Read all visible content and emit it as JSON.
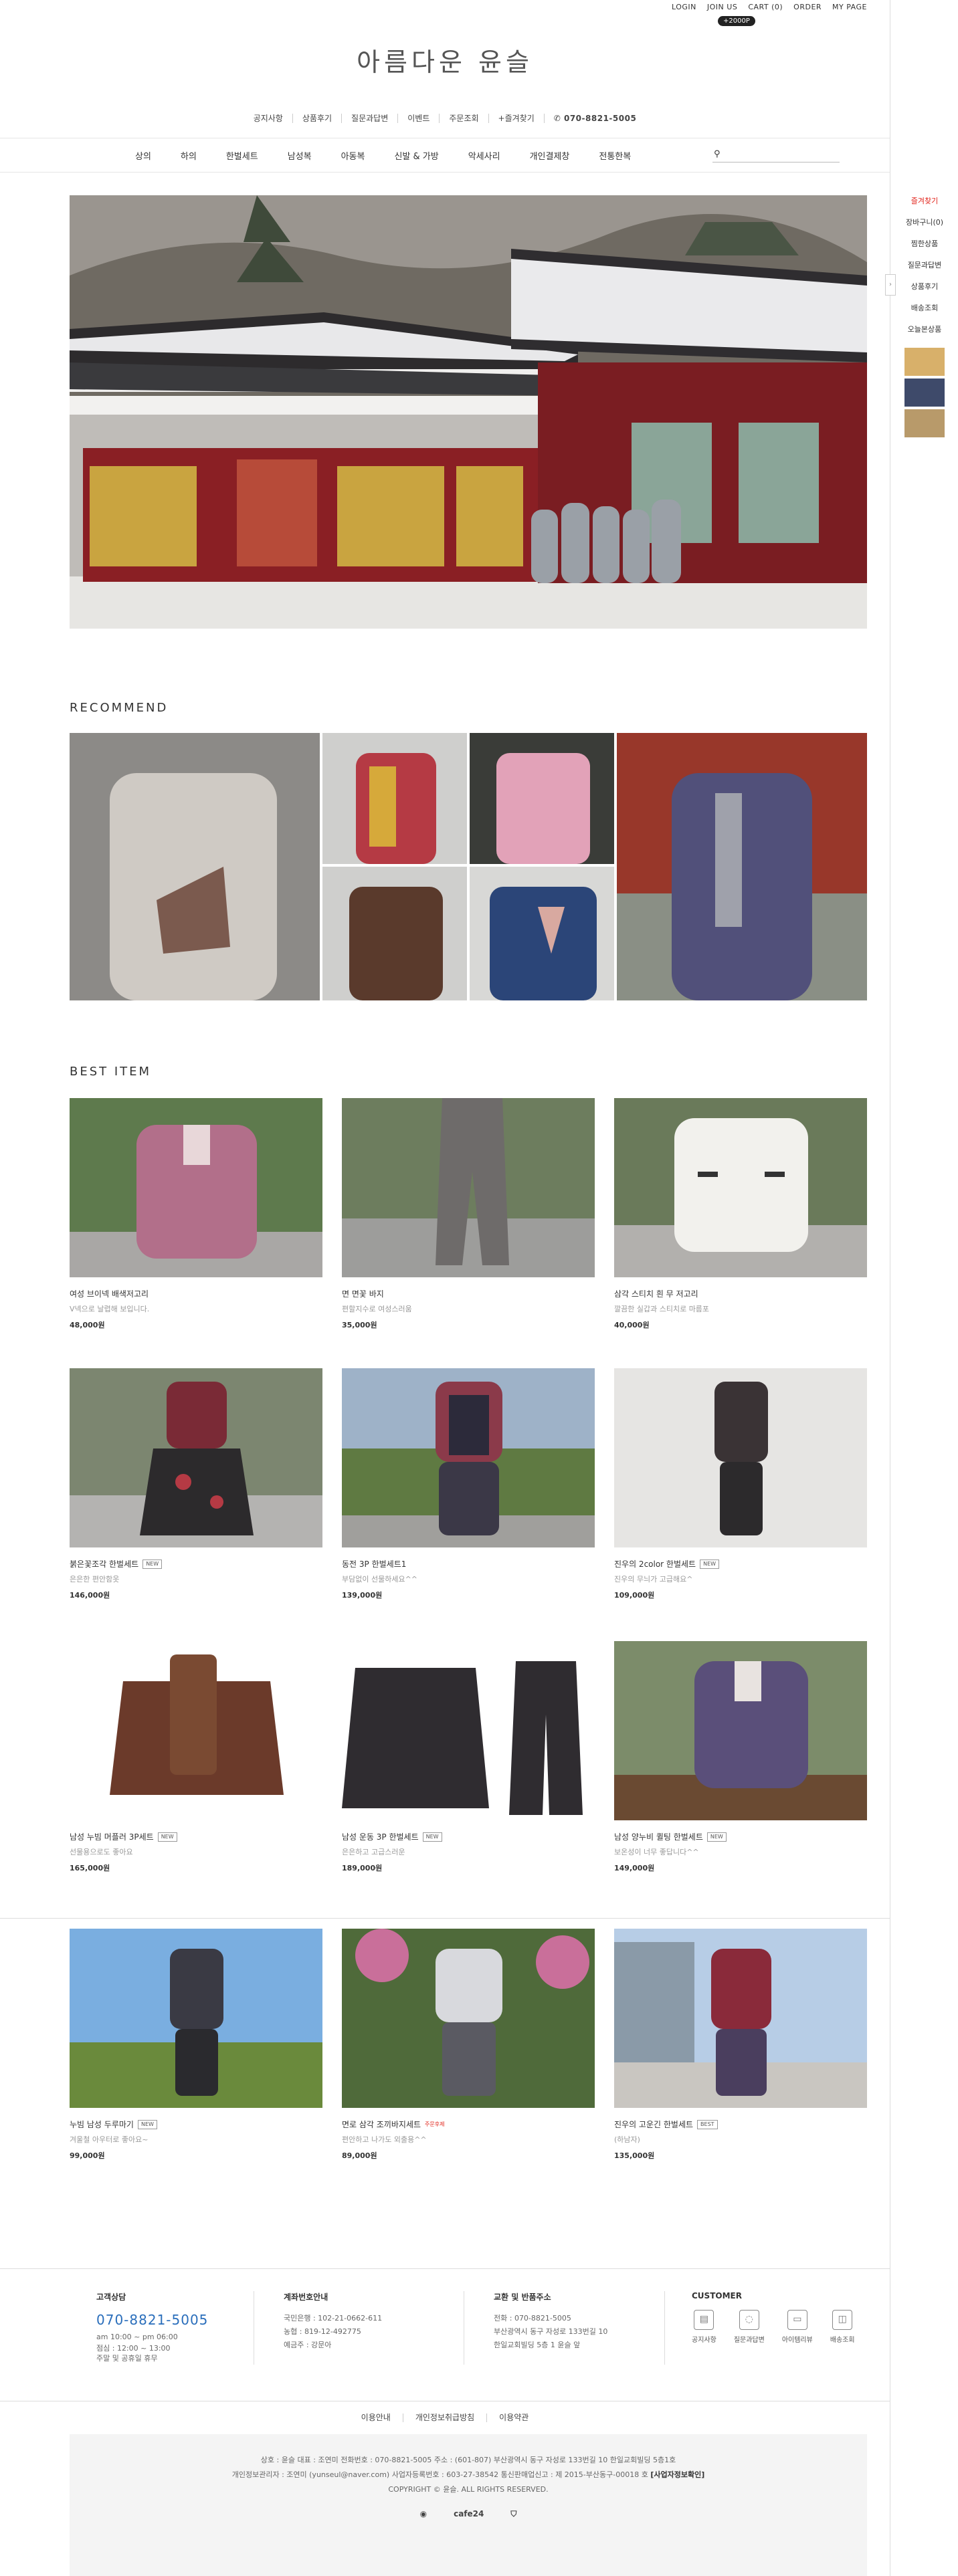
{
  "top_links": [
    "LOGIN",
    "JOIN US",
    "CART (0)",
    "ORDER",
    "MY PAGE"
  ],
  "point_badge": "+2000P",
  "logo": "아름다운 윤슬",
  "sub_nav": [
    "공지사항",
    "상품후기",
    "질문과답변",
    "이벤트",
    "주문조회",
    "+즐겨찾기"
  ],
  "phone": "070-8821-5005",
  "main_nav": [
    "상의",
    "하의",
    "한벌세트",
    "남성복",
    "아동복",
    "신발 & 가방",
    "악세사리",
    "개인결제창",
    "전통한복"
  ],
  "quick": {
    "items": [
      "즐겨찾기",
      "장바구니(0)",
      "찜한상품",
      "질문과답변",
      "상품후기",
      "배송조회",
      "오늘본상품"
    ]
  },
  "sections": {
    "recommend": "RECOMMEND",
    "best": "BEST ITEM"
  },
  "products": [
    {
      "name": "여성 브이넥 배색저고리",
      "desc": "V넥으로 날렵해 보입니다.",
      "price": "48,000원",
      "tag": ""
    },
    {
      "name": "면 면꽃 바지",
      "desc": "편할지수로 여성스러움",
      "price": "35,000원",
      "tag": ""
    },
    {
      "name": "삼각 스티치 흰 무 저고리",
      "desc": "깔끔한 실갑과 스티치로 마름포",
      "price": "40,000원",
      "tag": ""
    },
    {
      "name": "붉은꽃조각 한벌세트",
      "desc": "은은한 편안함옷",
      "price": "146,000원",
      "tag": "NEW"
    },
    {
      "name": "동전 3P 한벌세트1",
      "desc": "부담없이 선물하세요^^",
      "price": "139,000원",
      "tag": ""
    },
    {
      "name": "진우의 2color 한벌세트",
      "desc": "진우의 무늬가 고급해요^",
      "price": "109,000원",
      "tag": "NEW"
    },
    {
      "name": "남성 누빔 머플러 3P세트",
      "desc": "선물용으로도 좋아요",
      "price": "165,000원",
      "tag": "NEW"
    },
    {
      "name": "남성 운동 3P 한벌세트",
      "desc": "은은하고 고급스러운",
      "price": "189,000원",
      "tag": "NEW"
    },
    {
      "name": "남성 양누비 퀼팅 한벌세트",
      "desc": "보온성이 너무 좋답니다^^",
      "price": "149,000원",
      "tag": "NEW"
    },
    {
      "name": "누빔 남성 두루마기",
      "desc": "겨울철 아우터로 좋아요~",
      "price": "99,000원",
      "tag": "NEW"
    },
    {
      "name": "면로 삼각 조끼바지세트",
      "desc": "편안하고 나가도 외출용^^",
      "price": "89,000원",
      "tag": "주문후제"
    },
    {
      "name": "진우의 고운긴 한벌세트",
      "desc": "(하남자)",
      "price": "135,000원",
      "tag": "BEST"
    }
  ],
  "footer": {
    "cs_title": "고객상담",
    "cs_phone": "070-8821-5005",
    "cs_hours": "am 10:00 ~ pm 06:00",
    "cs_lunch": "점심 : 12:00 ~ 13:00",
    "cs_off": "주말 및 공휴일 휴무",
    "bank_title": "계좌번호안내",
    "bank1": "국민은행 : 102-21-0662-611",
    "bank2": "농협 : 819-12-492775",
    "bank_owner": "예금주 : 강문아",
    "return_title": "교환 및 반품주소",
    "return_phone": "전화 : 070-8821-5005",
    "return_addr": "부산광역시 동구 자성로 133번길 10",
    "return_addr2": "한일교회빌딩 5층 1 윤슬 앞",
    "customer_title": "CUSTOMER",
    "customer_items": [
      "공지사항",
      "질문과답변",
      "아이템리뷰",
      "배송조회"
    ],
    "links": [
      "이용안내",
      "개인정보취급방침",
      "이용약관"
    ],
    "biz1": "상호 : 윤슬   대표 : 조연미   전화번호 : 070-8821-5005   주소 : (601-807) 부산광역시 동구 자성로 133번길 10 한일교회빌딩 5층1호",
    "biz2": "개인정보관리자 : 조연미 (yunseul@naver.com)   사업자등록번호 : 603-27-38542   통신판매업신고 : 제 2015-부산동구-00018 호",
    "biz2_link": "[사업자정보확인]",
    "copyright": "COPYRIGHT © 윤슬. ALL RIGHTS RESERVED.",
    "logos": [
      "cafe24"
    ]
  },
  "colors": {
    "accent_blue": "#2a6ebb",
    "hot_red": "#e2231a"
  }
}
